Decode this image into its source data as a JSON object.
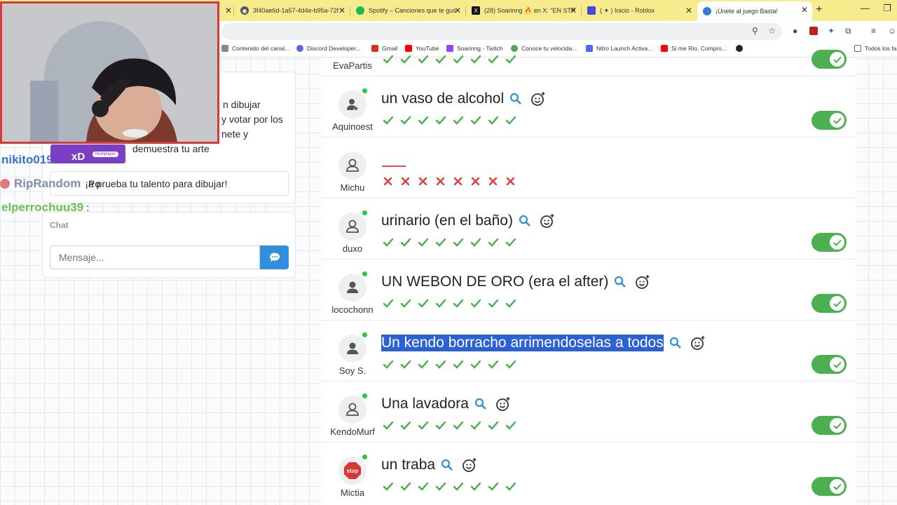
{
  "browser": {
    "tabs": [
      {
        "title": "3f40ae6d-1a57-4d4e-b95a-72f",
        "color": "#555555"
      },
      {
        "title": "Spotify – Canciones que te gus",
        "color": "#1db954"
      },
      {
        "title": "(28) Soarinng 🔥 en X: \"EN STR",
        "color": "#111111"
      },
      {
        "title": "( ✦ ) Inicio - Roblox",
        "color": "#4a4ad8"
      },
      {
        "title": "¡Únete al juego Basta!",
        "color": "#3a7bd5"
      }
    ],
    "bookmarks": [
      {
        "label": "Contenido del canal...",
        "color": "#888888"
      },
      {
        "label": "Discord Developer...",
        "color": "#5865f2"
      },
      {
        "label": "Gmail",
        "color": "#d93025"
      },
      {
        "label": "YouTube",
        "color": "#ff0000"
      },
      {
        "label": "Soarinng - Twitch",
        "color": "#9146ff"
      },
      {
        "label": "Conoce tu velocida...",
        "color": "#5aa05a"
      },
      {
        "label": "Nitro Launch Activa...",
        "color": "#5865f2"
      },
      {
        "label": "Si me Rio, Compro...",
        "color": "#ff0000"
      },
      {
        "label": "",
        "color": "#222222"
      },
      {
        "label": "Todos los fa",
        "color": "#666666"
      }
    ]
  },
  "left": {
    "desc_line1": "n dibujar",
    "desc_line2": "y votar por los",
    "desc_line3": "nete y",
    "desc_line4": "demuestra tu arte",
    "banner_text": "a prueba tu talento para dibujar!",
    "chat_label": "Chat",
    "message_placeholder": "Mensaje..."
  },
  "overlay": {
    "chat": [
      {
        "name": "nikito019",
        "color": "#3b6fd8"
      },
      {
        "name": "RipRandom",
        "color": "#7f8fa6",
        "message": "¡Po"
      },
      {
        "name": "elperrochuu39",
        "color": "#6cc24a",
        "message": ":"
      }
    ],
    "badge_text": "xD",
    "badge_small": "Multiplayer"
  },
  "results": [
    {
      "user": "EvaPartis",
      "answer": "",
      "marks": [
        "ok",
        "ok",
        "ok",
        "ok",
        "ok",
        "ok",
        "ok",
        "ok"
      ],
      "toggle": true
    },
    {
      "user": "Aquinoest",
      "answer": "un vaso de alcohol",
      "marks": [
        "ok",
        "ok",
        "ok",
        "ok",
        "ok",
        "ok",
        "ok",
        "ok"
      ],
      "toggle": true
    },
    {
      "user": "Michu",
      "answer": "",
      "marks": [
        "x",
        "x",
        "x",
        "x",
        "x",
        "x",
        "x",
        "x"
      ],
      "toggle": false
    },
    {
      "user": "duxo",
      "answer": "urinario (en el baño)",
      "marks": [
        "ok",
        "ok",
        "ok",
        "ok",
        "ok",
        "ok",
        "ok",
        "ok"
      ],
      "toggle": true
    },
    {
      "user": "locochonn",
      "answer": "UN WEBON DE ORO (era el after)",
      "marks": [
        "ok",
        "ok",
        "ok",
        "ok",
        "ok",
        "ok",
        "ok",
        "ok"
      ],
      "toggle": true
    },
    {
      "user": "Soy S.",
      "answer": "Un kendo borracho arrimendoselas a todos",
      "selected": true,
      "marks": [
        "ok",
        "ok",
        "ok",
        "ok",
        "ok",
        "ok",
        "ok",
        "ok"
      ],
      "toggle": true
    },
    {
      "user": "KendoMurf",
      "answer": "Una lavadora",
      "marks": [
        "ok",
        "ok",
        "ok",
        "ok",
        "ok",
        "ok",
        "ok",
        "ok"
      ],
      "toggle": true
    },
    {
      "user": "Mictia",
      "answer": "un traba",
      "avatar": "stop",
      "marks": [
        "ok",
        "ok",
        "ok",
        "ok",
        "ok",
        "ok",
        "ok",
        "ok"
      ],
      "toggle": true
    }
  ],
  "colors": {
    "check": "#43b047",
    "cross": "#e03c3c",
    "toggle_on": "#4caf50",
    "accent": "#2f8fdd"
  }
}
